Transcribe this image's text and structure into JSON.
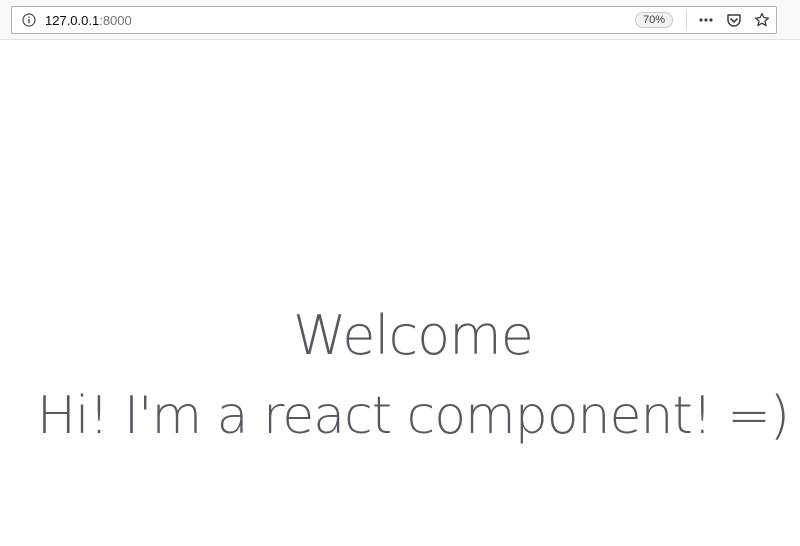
{
  "browser": {
    "url_host": "127.0.0.1",
    "url_port": ":8000",
    "zoom": "70%",
    "icons": [
      "info-icon",
      "page-actions-menu-icon",
      "pocket-icon",
      "bookmark-star-icon"
    ]
  },
  "page": {
    "heading": "Welcome",
    "message": "Hi! I'm a react component! =)"
  },
  "colors": {
    "text": "#555a61",
    "toolbar_bg": "#f9f9fa"
  }
}
